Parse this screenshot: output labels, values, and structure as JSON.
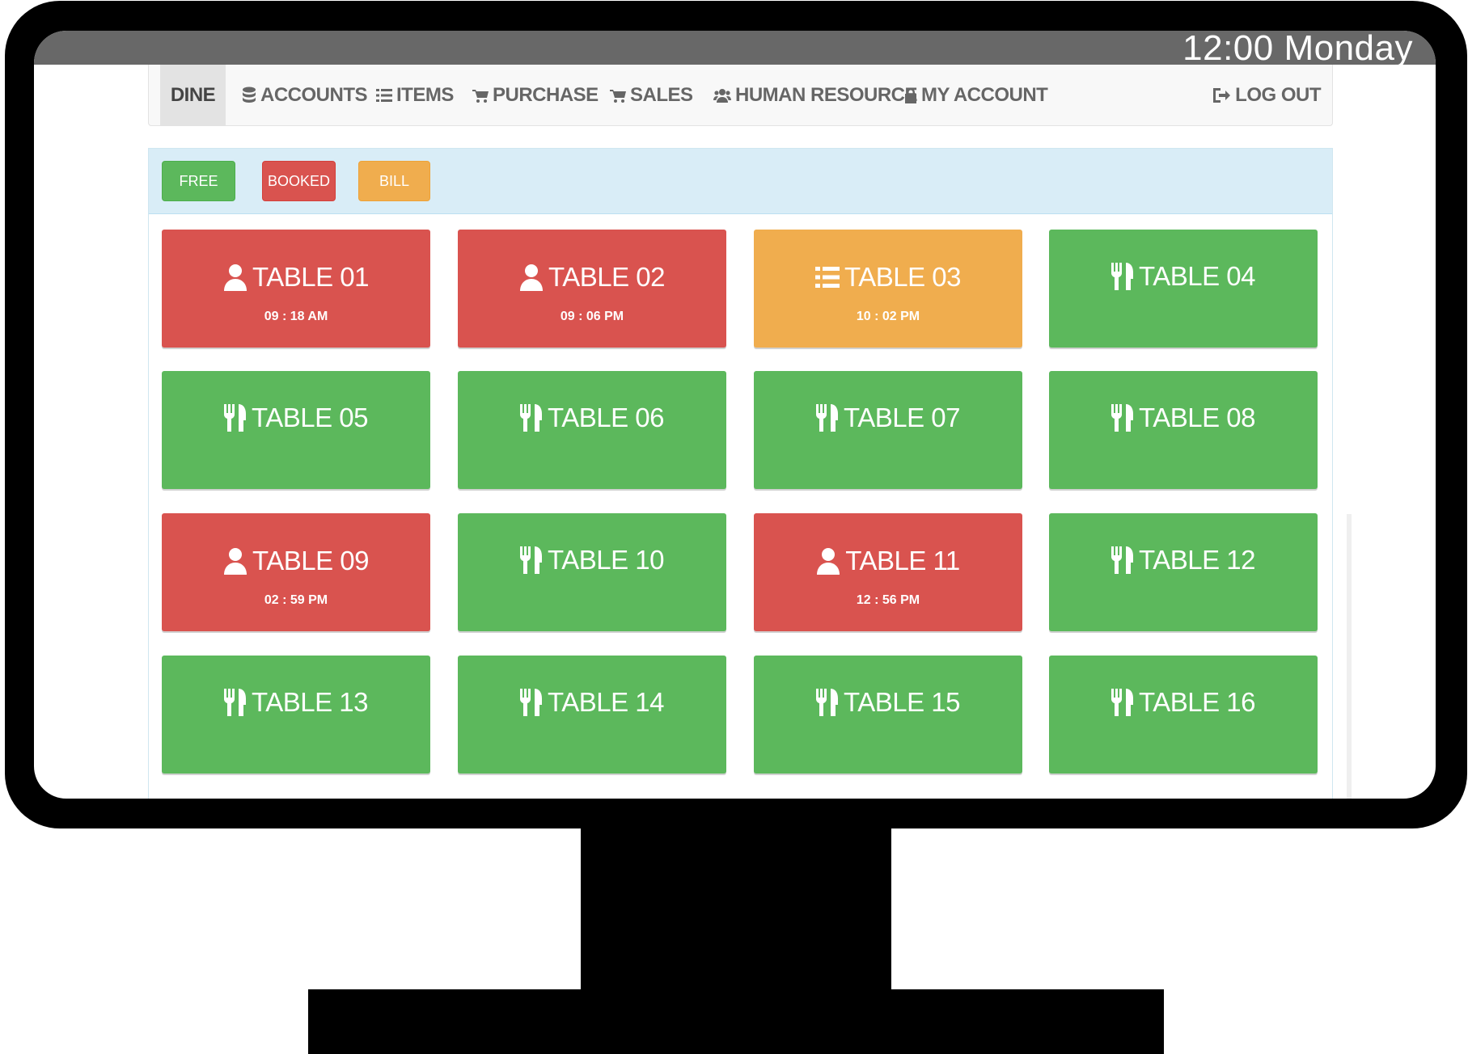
{
  "os": {
    "clock": "12:00 Monday"
  },
  "nav": {
    "items": [
      {
        "label": "DINE",
        "icon": "",
        "active": true
      },
      {
        "label": "ACCOUNTS",
        "icon": "database-icon"
      },
      {
        "label": "ITEMS",
        "icon": "list-icon"
      },
      {
        "label": "PURCHASE",
        "icon": "cart-icon"
      },
      {
        "label": "SALES",
        "icon": "cart-icon"
      },
      {
        "label": "HUMAN RESOURCE",
        "icon": "users-icon"
      },
      {
        "label": "MY ACCOUNT",
        "icon": "lock-icon"
      }
    ],
    "logout": {
      "label": "LOG OUT",
      "icon": "logout-icon"
    }
  },
  "legend": {
    "free": "FREE",
    "booked": "BOOKED",
    "bill": "BILL"
  },
  "colors": {
    "free": "#5cb85c",
    "booked": "#d9534f",
    "bill": "#f0ad4e"
  },
  "tables": [
    {
      "name": "TABLE 01",
      "status": "booked",
      "icon": "user-icon",
      "time": "09 : 18 AM"
    },
    {
      "name": "TABLE 02",
      "status": "booked",
      "icon": "user-icon",
      "time": "09 : 06 PM"
    },
    {
      "name": "TABLE 03",
      "status": "bill",
      "icon": "list-icon",
      "time": "10 : 02 PM"
    },
    {
      "name": "TABLE 04",
      "status": "free",
      "icon": "cutlery-icon",
      "time": ""
    },
    {
      "name": "TABLE 05",
      "status": "free",
      "icon": "cutlery-icon",
      "time": ""
    },
    {
      "name": "TABLE 06",
      "status": "free",
      "icon": "cutlery-icon",
      "time": ""
    },
    {
      "name": "TABLE 07",
      "status": "free",
      "icon": "cutlery-icon",
      "time": ""
    },
    {
      "name": "TABLE 08",
      "status": "free",
      "icon": "cutlery-icon",
      "time": ""
    },
    {
      "name": "TABLE 09",
      "status": "booked",
      "icon": "user-icon",
      "time": "02 : 59 PM"
    },
    {
      "name": "TABLE 10",
      "status": "free",
      "icon": "cutlery-icon",
      "time": ""
    },
    {
      "name": "TABLE 11",
      "status": "booked",
      "icon": "user-icon",
      "time": "12 : 56 PM"
    },
    {
      "name": "TABLE 12",
      "status": "free",
      "icon": "cutlery-icon",
      "time": ""
    },
    {
      "name": "TABLE 13",
      "status": "free",
      "icon": "cutlery-icon",
      "time": ""
    },
    {
      "name": "TABLE 14",
      "status": "free",
      "icon": "cutlery-icon",
      "time": ""
    },
    {
      "name": "TABLE 15",
      "status": "free",
      "icon": "cutlery-icon",
      "time": ""
    },
    {
      "name": "TABLE 16",
      "status": "free",
      "icon": "cutlery-icon",
      "time": ""
    }
  ]
}
